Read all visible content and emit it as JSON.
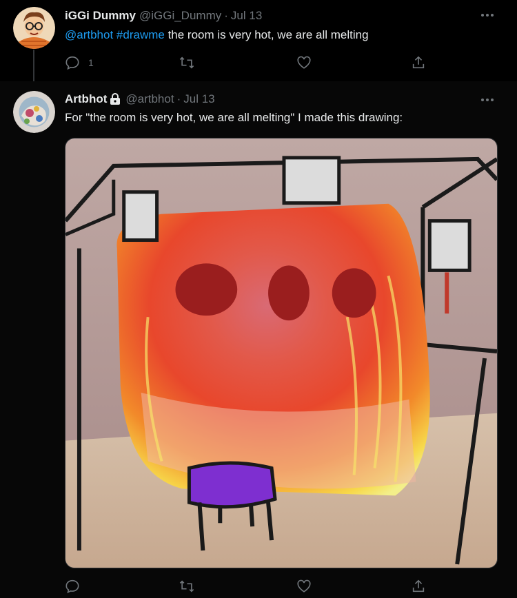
{
  "tweets": [
    {
      "display_name": "iGGi Dummy",
      "handle": "@iGGi_Dummy",
      "dot": "·",
      "date": "Jul 13",
      "mention": "@artbhot",
      "hashtag": "#drawme",
      "text": " the room is very hot, we are all melting",
      "reply_count": "1",
      "avatar_icon": "cartoon-avatar"
    },
    {
      "display_name": "Artbhot",
      "handle": "@artbhot",
      "dot": "·",
      "date": "Jul 13",
      "text": "For \"the room is very hot, we are all melting\" I made this drawing:",
      "verified_icon": "lock-icon",
      "avatar_icon": "abstract-avatar"
    }
  ],
  "colors": {
    "background": "#000000",
    "text": "#e7e9ea",
    "muted": "#71767b",
    "link": "#1d9bf0"
  }
}
